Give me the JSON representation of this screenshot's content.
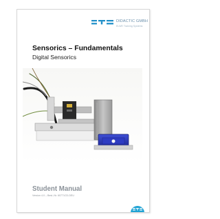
{
  "header": {
    "logo_text": "DIDACTIC GMBH",
    "logo_subtext": "ELWE Training Systems"
  },
  "title": "Sensorics – Fundamentals",
  "subtitle": "Digital Sensorics",
  "manual_title": "Student Manual",
  "version_text": "Version 4.0 – Best.-Nr. 60771CD-DEU",
  "footer_logo_text": "ETS",
  "colors": {
    "brand_blue": "#1e8ec8",
    "logo_grey_blue": "#6a8fab",
    "manual_grey": "#8b9299",
    "holder_blue": "#2533b4"
  }
}
